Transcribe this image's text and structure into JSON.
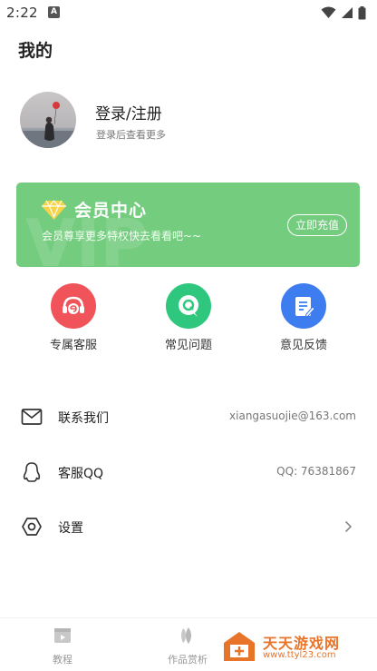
{
  "status_bar": {
    "time": "2:22",
    "notification_letter": "A"
  },
  "page": {
    "title": "我的"
  },
  "profile": {
    "login_title": "登录/注册",
    "login_subtitle": "登录后查看更多"
  },
  "vip": {
    "title": "会员中心",
    "description": "会员尊享更多特权快去看看吧~~",
    "recharge_label": "立即充值",
    "watermark_text": "VIP",
    "color": "#74cc7f"
  },
  "shortcuts": [
    {
      "label": "专属客服",
      "icon": "headset-icon",
      "color": "#f0545a"
    },
    {
      "label": "常见问题",
      "icon": "question-bubble-icon",
      "color": "#2fc77e"
    },
    {
      "label": "意见反馈",
      "icon": "feedback-doc-icon",
      "color": "#3d7df0"
    }
  ],
  "list": [
    {
      "label": "联系我们",
      "value": "xiangasuojie@163.com",
      "icon": "mail-icon"
    },
    {
      "label": "客服QQ",
      "value": "QQ: 76381867",
      "icon": "qq-icon"
    },
    {
      "label": "设置",
      "value": "",
      "icon": "settings-icon"
    }
  ],
  "bottom_nav": [
    {
      "label": "教程",
      "icon": "tutorial-icon"
    },
    {
      "label": "作品赏析",
      "icon": "works-icon"
    }
  ],
  "watermark": {
    "title": "天天游戏网",
    "url": "www.ttyl23.com"
  }
}
